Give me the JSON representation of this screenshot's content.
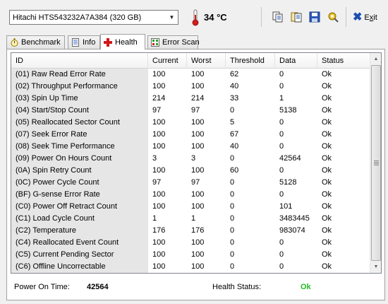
{
  "toolbar": {
    "drive": "Hitachi HTS543232A7A384 (320 GB)",
    "temperature": "34 °C",
    "buttons": [
      "copy-icon",
      "copy-all-icon",
      "save-icon",
      "options-icon"
    ],
    "exit_prefix": "E",
    "exit_underlined": "x",
    "exit_suffix": "it"
  },
  "tabs": [
    {
      "label": "Benchmark",
      "icon": "stopwatch-icon"
    },
    {
      "label": "Info",
      "icon": "info-icon"
    },
    {
      "label": "Health",
      "icon": "red-cross-icon",
      "active": true
    },
    {
      "label": "Error Scan",
      "icon": "error-scan-icon"
    }
  ],
  "table": {
    "columns": [
      "ID",
      "Current",
      "Worst",
      "Threshold",
      "Data",
      "Status"
    ],
    "rows": [
      [
        "(01) Raw Read Error Rate",
        "100",
        "100",
        "62",
        "0",
        "Ok"
      ],
      [
        "(02) Throughput Performance",
        "100",
        "100",
        "40",
        "0",
        "Ok"
      ],
      [
        "(03) Spin Up Time",
        "214",
        "214",
        "33",
        "1",
        "Ok"
      ],
      [
        "(04) Start/Stop Count",
        "97",
        "97",
        "0",
        "5138",
        "Ok"
      ],
      [
        "(05) Reallocated Sector Count",
        "100",
        "100",
        "5",
        "0",
        "Ok"
      ],
      [
        "(07) Seek Error Rate",
        "100",
        "100",
        "67",
        "0",
        "Ok"
      ],
      [
        "(08) Seek Time Performance",
        "100",
        "100",
        "40",
        "0",
        "Ok"
      ],
      [
        "(09) Power On Hours Count",
        "3",
        "3",
        "0",
        "42564",
        "Ok"
      ],
      [
        "(0A) Spin Retry Count",
        "100",
        "100",
        "60",
        "0",
        "Ok"
      ],
      [
        "(0C) Power Cycle Count",
        "97",
        "97",
        "0",
        "5128",
        "Ok"
      ],
      [
        "(BF) G-sense Error Rate",
        "100",
        "100",
        "0",
        "0",
        "Ok"
      ],
      [
        "(C0) Power Off Retract Count",
        "100",
        "100",
        "0",
        "101",
        "Ok"
      ],
      [
        "(C1) Load Cycle Count",
        "1",
        "1",
        "0",
        "3483445",
        "Ok"
      ],
      [
        "(C2) Temperature",
        "176",
        "176",
        "0",
        "983074",
        "Ok"
      ],
      [
        "(C4) Reallocated Event Count",
        "100",
        "100",
        "0",
        "0",
        "Ok"
      ],
      [
        "(C5) Current Pending Sector",
        "100",
        "100",
        "0",
        "0",
        "Ok"
      ],
      [
        "(C6) Offline Uncorrectable",
        "100",
        "100",
        "0",
        "0",
        "Ok"
      ]
    ]
  },
  "footer": {
    "power_on_label": "Power On Time:",
    "power_on_value": "42564",
    "health_label": "Health Status:",
    "health_value": "Ok",
    "health_color": "#22bb22"
  }
}
